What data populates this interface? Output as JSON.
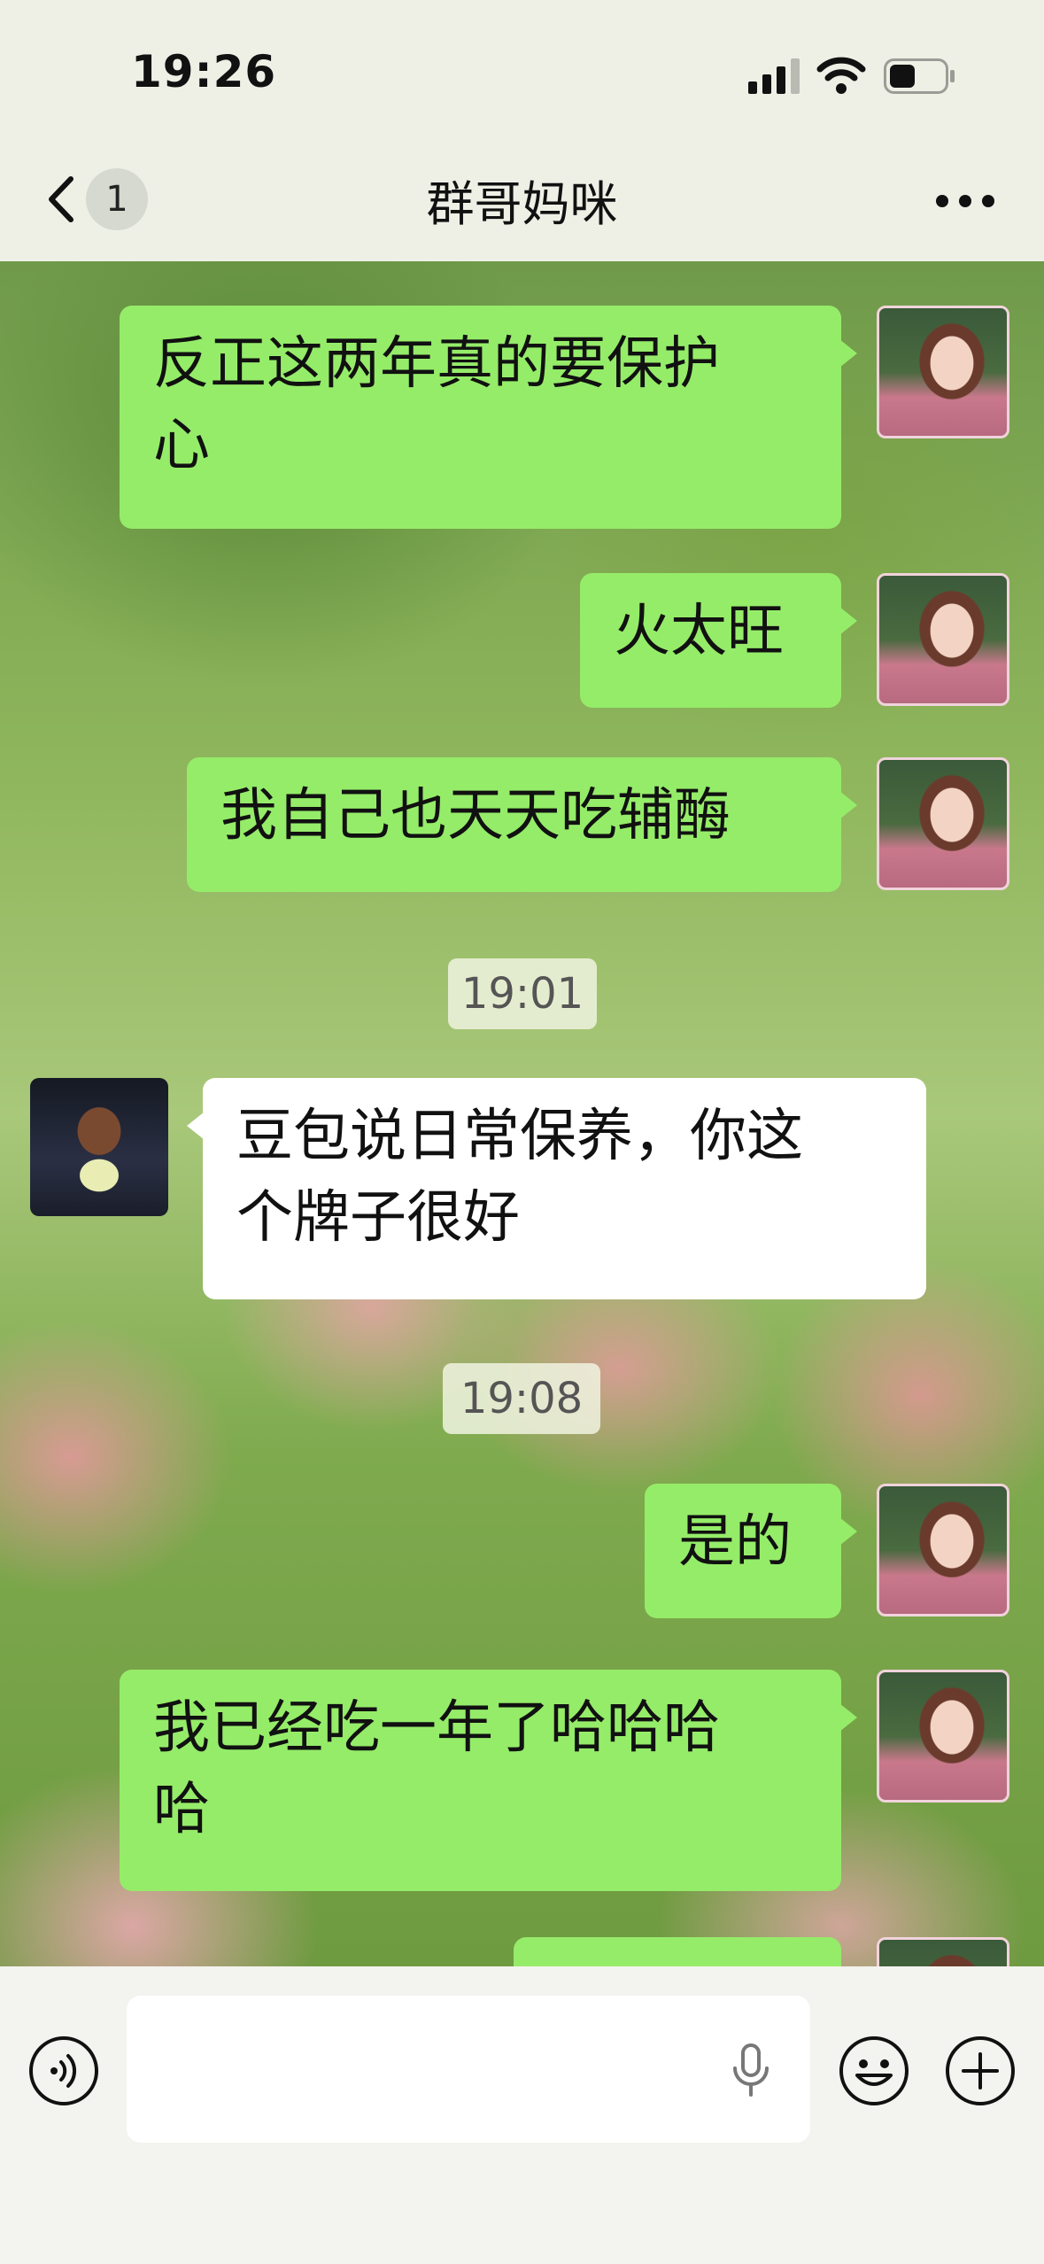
{
  "status_bar": {
    "time": "19:26",
    "icons": [
      "cellular-signal-icon",
      "wifi-icon",
      "battery-icon"
    ]
  },
  "nav": {
    "back_icon": "chevron-left-icon",
    "unread_count": "1",
    "title": "群哥妈咪",
    "more_icon": "more-dots-icon"
  },
  "messages": [
    {
      "sender": "me",
      "text_lines": [
        "反正这两年真的要保护",
        "心"
      ]
    },
    {
      "sender": "me",
      "text_lines": [
        "火太旺"
      ]
    },
    {
      "sender": "me",
      "text_lines": [
        "我自己也天天吃辅酶"
      ]
    },
    {
      "timestamp": "19:01"
    },
    {
      "sender": "other",
      "text_lines": [
        "豆包说日常保养，你这",
        "个牌子很好"
      ]
    },
    {
      "timestamp": "19:08"
    },
    {
      "sender": "me",
      "text_lines": [
        "是的"
      ]
    },
    {
      "sender": "me",
      "text_lines": [
        "我已经吃一年了哈哈哈",
        "哈"
      ]
    },
    {
      "sender": "me",
      "text_lines": [
        ""
      ]
    }
  ],
  "input_bar": {
    "voice_icon": "voice-mode-icon",
    "input_value": "",
    "mic_icon": "microphone-icon",
    "emoji_icon": "emoji-icon",
    "plus_icon": "plus-icon"
  },
  "colors": {
    "my_bubble": "#95ec69",
    "their_bubble": "#ffffff",
    "topbar": "#eef0e6"
  }
}
